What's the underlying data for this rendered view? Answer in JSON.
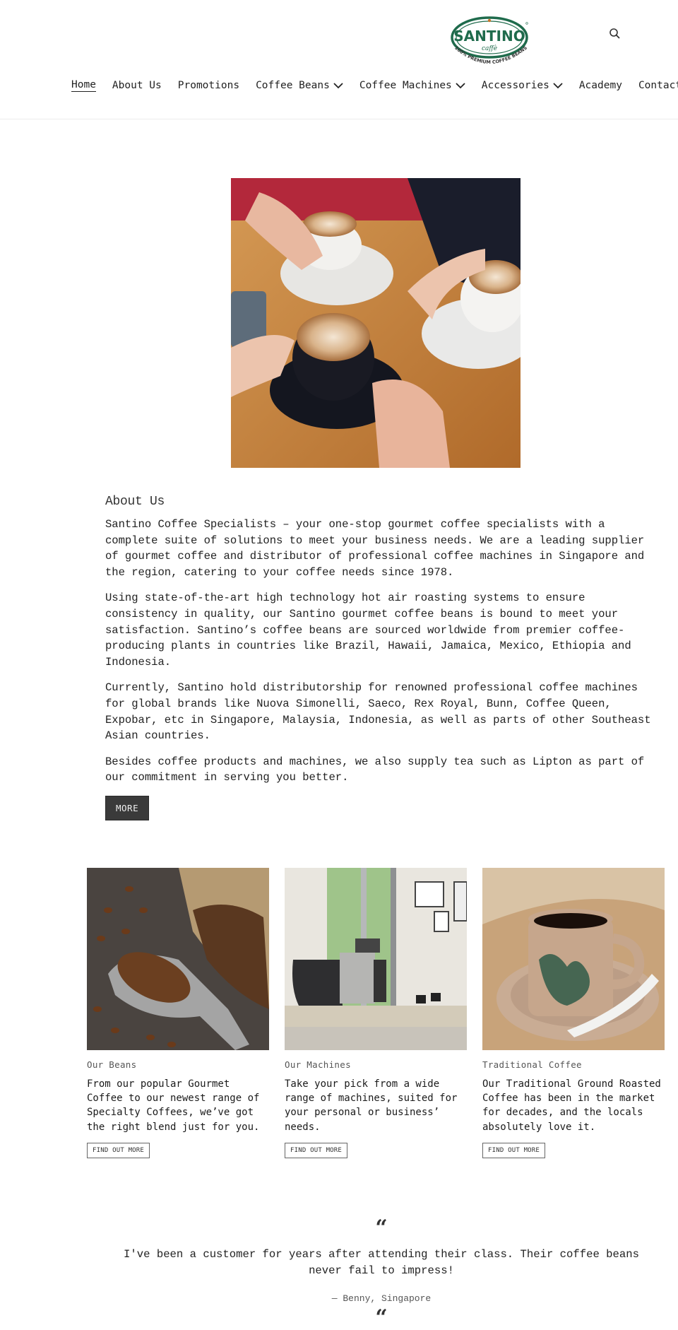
{
  "brand": {
    "name": "SANTINO",
    "sub": "caffè",
    "tagline": "100% PREMIUM COFFEE BEANS",
    "color": "#1f6b4c"
  },
  "header": {
    "search_icon": "search-icon"
  },
  "nav": [
    {
      "label": "Home",
      "active": true,
      "dropdown": false
    },
    {
      "label": "About Us",
      "active": false,
      "dropdown": false
    },
    {
      "label": "Promotions",
      "active": false,
      "dropdown": false
    },
    {
      "label": "Coffee Beans",
      "active": false,
      "dropdown": true
    },
    {
      "label": "Coffee Machines",
      "active": false,
      "dropdown": true
    },
    {
      "label": "Accessories",
      "active": false,
      "dropdown": true
    },
    {
      "label": "Academy",
      "active": false,
      "dropdown": false
    },
    {
      "label": "Contact Us",
      "active": false,
      "dropdown": false
    }
  ],
  "hero": {
    "image": "friends-holding-cappuccino-cups-photo"
  },
  "about": {
    "title": "About Us",
    "paragraphs": [
      "Santino Coffee Specialists – your one-stop gourmet coffee specialists with a complete suite of solutions to meet your business needs. We are a leading supplier of gourmet coffee and distributor of professional coffee machines in Singapore and the region, catering to your coffee needs since 1978.",
      "Using state-of-the-art high technology hot air roasting systems to ensure consistency in quality, our Santino gourmet coffee beans is bound to meet your satisfaction. Santino’s coffee beans are sourced worldwide from premier coffee-producing plants in countries like Brazil, Hawaii, Jamaica, Mexico, Ethiopia and Indonesia.",
      "Currently, Santino hold distributorship for renowned professional coffee machines for global brands like Nuova Simonelli, Saeco, Rex Royal, Bunn, Coffee Queen, Expobar, etc in Singapore, Malaysia, Indonesia, as well as parts of other Southeast Asian countries.",
      "Besides coffee products and machines, we also supply tea such as Lipton as part of our commitment in serving you better."
    ],
    "button": "MORE"
  },
  "cards": [
    {
      "image": "coffee-beans-scoop-burlap-photo",
      "title": "Our Beans",
      "text": "From our popular Gourmet Coffee to our newest range of Specialty Coffees, we’ve got the right blend just for you.",
      "button": "FIND OUT MORE"
    },
    {
      "image": "espresso-machine-kitchen-photo",
      "title": "Our Machines",
      "text": "Take your pick from a wide range of machines, suited for your personal or business’ needs.",
      "button": "FIND OUT MORE"
    },
    {
      "image": "traditional-kopitiam-cup-photo",
      "title": "Traditional Coffee",
      "text": "Our Traditional Ground Roasted Coffee has been in the market for decades, and the locals absolutely love it.",
      "button": "FIND OUT MORE"
    }
  ],
  "testimonial": {
    "open_mark": "“",
    "quote": "I've been a customer for years after attending their class. Their coffee beans never fail to impress!",
    "author": "— Benny, Singapore",
    "next_mark": "“"
  }
}
